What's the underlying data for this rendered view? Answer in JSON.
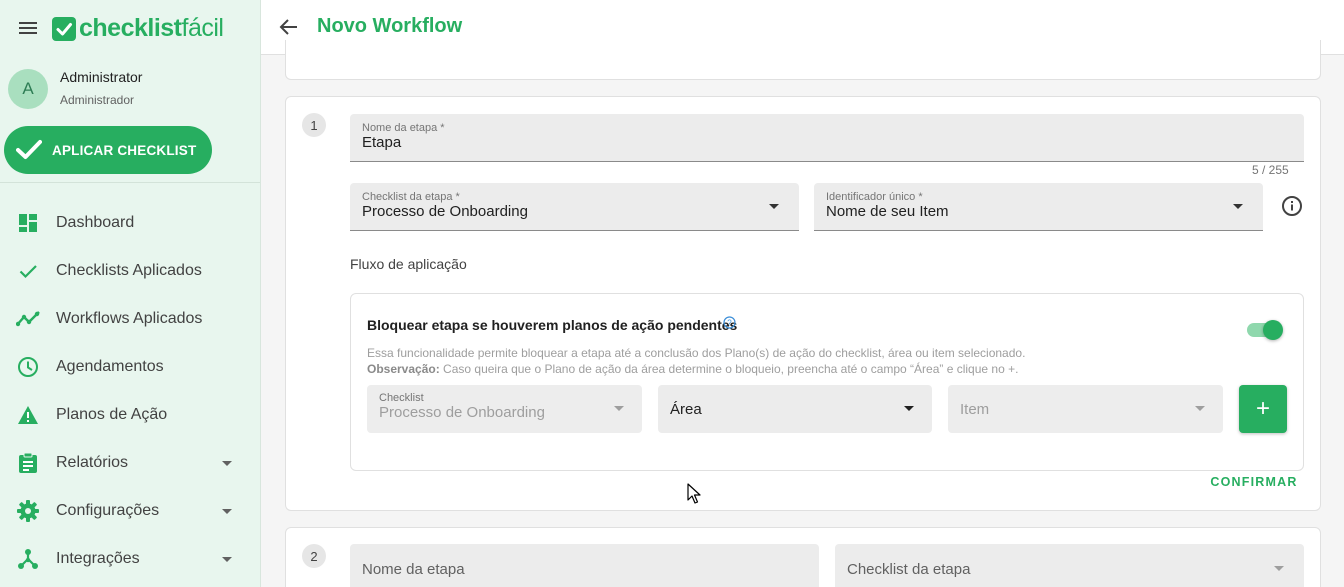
{
  "app": {
    "logo_bold": "checklist",
    "logo_light": "fácil",
    "brand_color": "#27ae60"
  },
  "user": {
    "avatar_initial": "A",
    "name": "Administrator",
    "role": "Administrador"
  },
  "sidebar": {
    "apply_button": "APLICAR CHECKLIST",
    "items": [
      {
        "label": "Dashboard",
        "icon": "dashboard-icon"
      },
      {
        "label": "Checklists Aplicados",
        "icon": "check-icon"
      },
      {
        "label": "Workflows Aplicados",
        "icon": "trending-icon"
      },
      {
        "label": "Agendamentos",
        "icon": "clock-icon"
      },
      {
        "label": "Planos de Ação",
        "icon": "warning-icon"
      },
      {
        "label": "Relatórios",
        "icon": "clipboard-icon",
        "expandable": true
      },
      {
        "label": "Configurações",
        "icon": "gear-icon",
        "expandable": true
      },
      {
        "label": "Integrações",
        "icon": "hub-icon",
        "expandable": true
      }
    ]
  },
  "header": {
    "title": "Novo Workflow"
  },
  "step1": {
    "number": "1",
    "name_label": "Nome da etapa *",
    "name_value": "Etapa",
    "counter": "5 / 255",
    "checklist_label": "Checklist da etapa *",
    "checklist_value": "Processo de Onboarding",
    "identifier_label": "Identificador único *",
    "identifier_value": "Nome de seu Item",
    "flow_label": "Fluxo de aplicação",
    "block": {
      "title": "Bloquear etapa se houverem planos de ação pendentes",
      "enabled": true,
      "description": "Essa funcionalidade permite bloquear a etapa até a conclusão dos Plano(s) de ação do checklist, área ou item selecionado.",
      "note_label": "Observação:",
      "note_text": "Caso queira que o Plano de ação da área determine o bloqueio, preencha até o campo “Área” e clique no +.",
      "checklist_label": "Checklist",
      "checklist_value": "Processo de Onboarding",
      "area_value": "Área",
      "item_placeholder": "Item",
      "add_label": "+"
    },
    "confirm": "CONFIRMAR"
  },
  "step2": {
    "number": "2",
    "name_placeholder": "Nome da etapa",
    "checklist_placeholder": "Checklist da etapa"
  }
}
